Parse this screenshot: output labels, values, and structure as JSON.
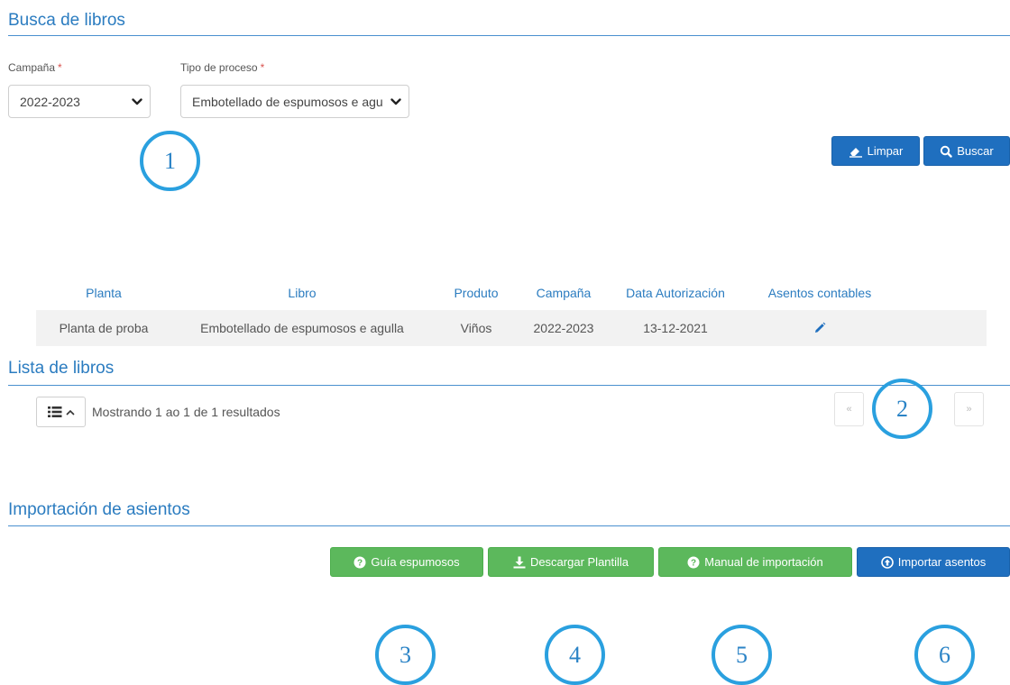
{
  "search": {
    "title": "Busca de libros",
    "campaign": {
      "label": "Campaña",
      "required_mark": "*",
      "value": "2022-2023"
    },
    "process": {
      "label": "Tipo de proceso",
      "required_mark": "*",
      "value": "Embotellado de espumosos e agulla"
    },
    "buttons": {
      "clear": "Limpar",
      "search": "Buscar"
    }
  },
  "list": {
    "title": "Lista de libros",
    "columns": [
      "Planta",
      "Libro",
      "Produto",
      "Campaña",
      "Data Autorización",
      "Asentos contables"
    ],
    "rows": [
      {
        "planta": "Planta de proba",
        "libro": "Embotellado de espumosos e agulla",
        "produto": "Viños",
        "campana": "2022-2023",
        "data": "13-12-2021",
        "action_icon": "pencil-icon"
      }
    ],
    "results_text": "Mostrando 1 ao 1 de 1 resultados",
    "pagination": {
      "prev": "«",
      "next": "»"
    }
  },
  "import": {
    "title": "Importación de asientos",
    "buttons": {
      "guide": "Guía espumosos",
      "download": "Descargar Plantilla",
      "manual": "Manual de importación",
      "import": "Importar asentos"
    }
  },
  "callouts": [
    "1",
    "2",
    "3",
    "4",
    "5",
    "6"
  ],
  "colors": {
    "primary": "#1f6fbf",
    "success": "#5cb85c",
    "heading": "#2b7cc0",
    "callout": "#2aa0df",
    "required": "#d9534f"
  }
}
